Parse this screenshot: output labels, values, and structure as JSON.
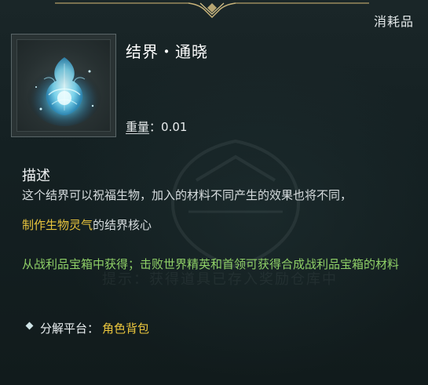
{
  "item": {
    "category": "消耗品",
    "name": "结界・通晓",
    "weight_label": "重量",
    "weight_separator": "：",
    "weight_value": "0.01",
    "icon": "blue-crystal-barrier-icon"
  },
  "description": {
    "title": "描述",
    "line1": "这个结界可以祝福生物，加入的材料不同产生的效果也将不同，",
    "highlight": "制作生物灵气",
    "line2_rest": "的结界核心"
  },
  "source": {
    "text": "从战利品宝箱中获得；击败世界精英和首领可获得合成战利品宝箱的材料"
  },
  "watermark": {
    "text": "提示：获得道具已存入奖励仓库中"
  },
  "platform": {
    "label": "分解平台：",
    "value": "角色背包"
  },
  "colors": {
    "background": "#142022",
    "highlight_yellow": "#e9c53d",
    "source_green": "#8fd067",
    "ornament_gold": "#b9a36a"
  }
}
